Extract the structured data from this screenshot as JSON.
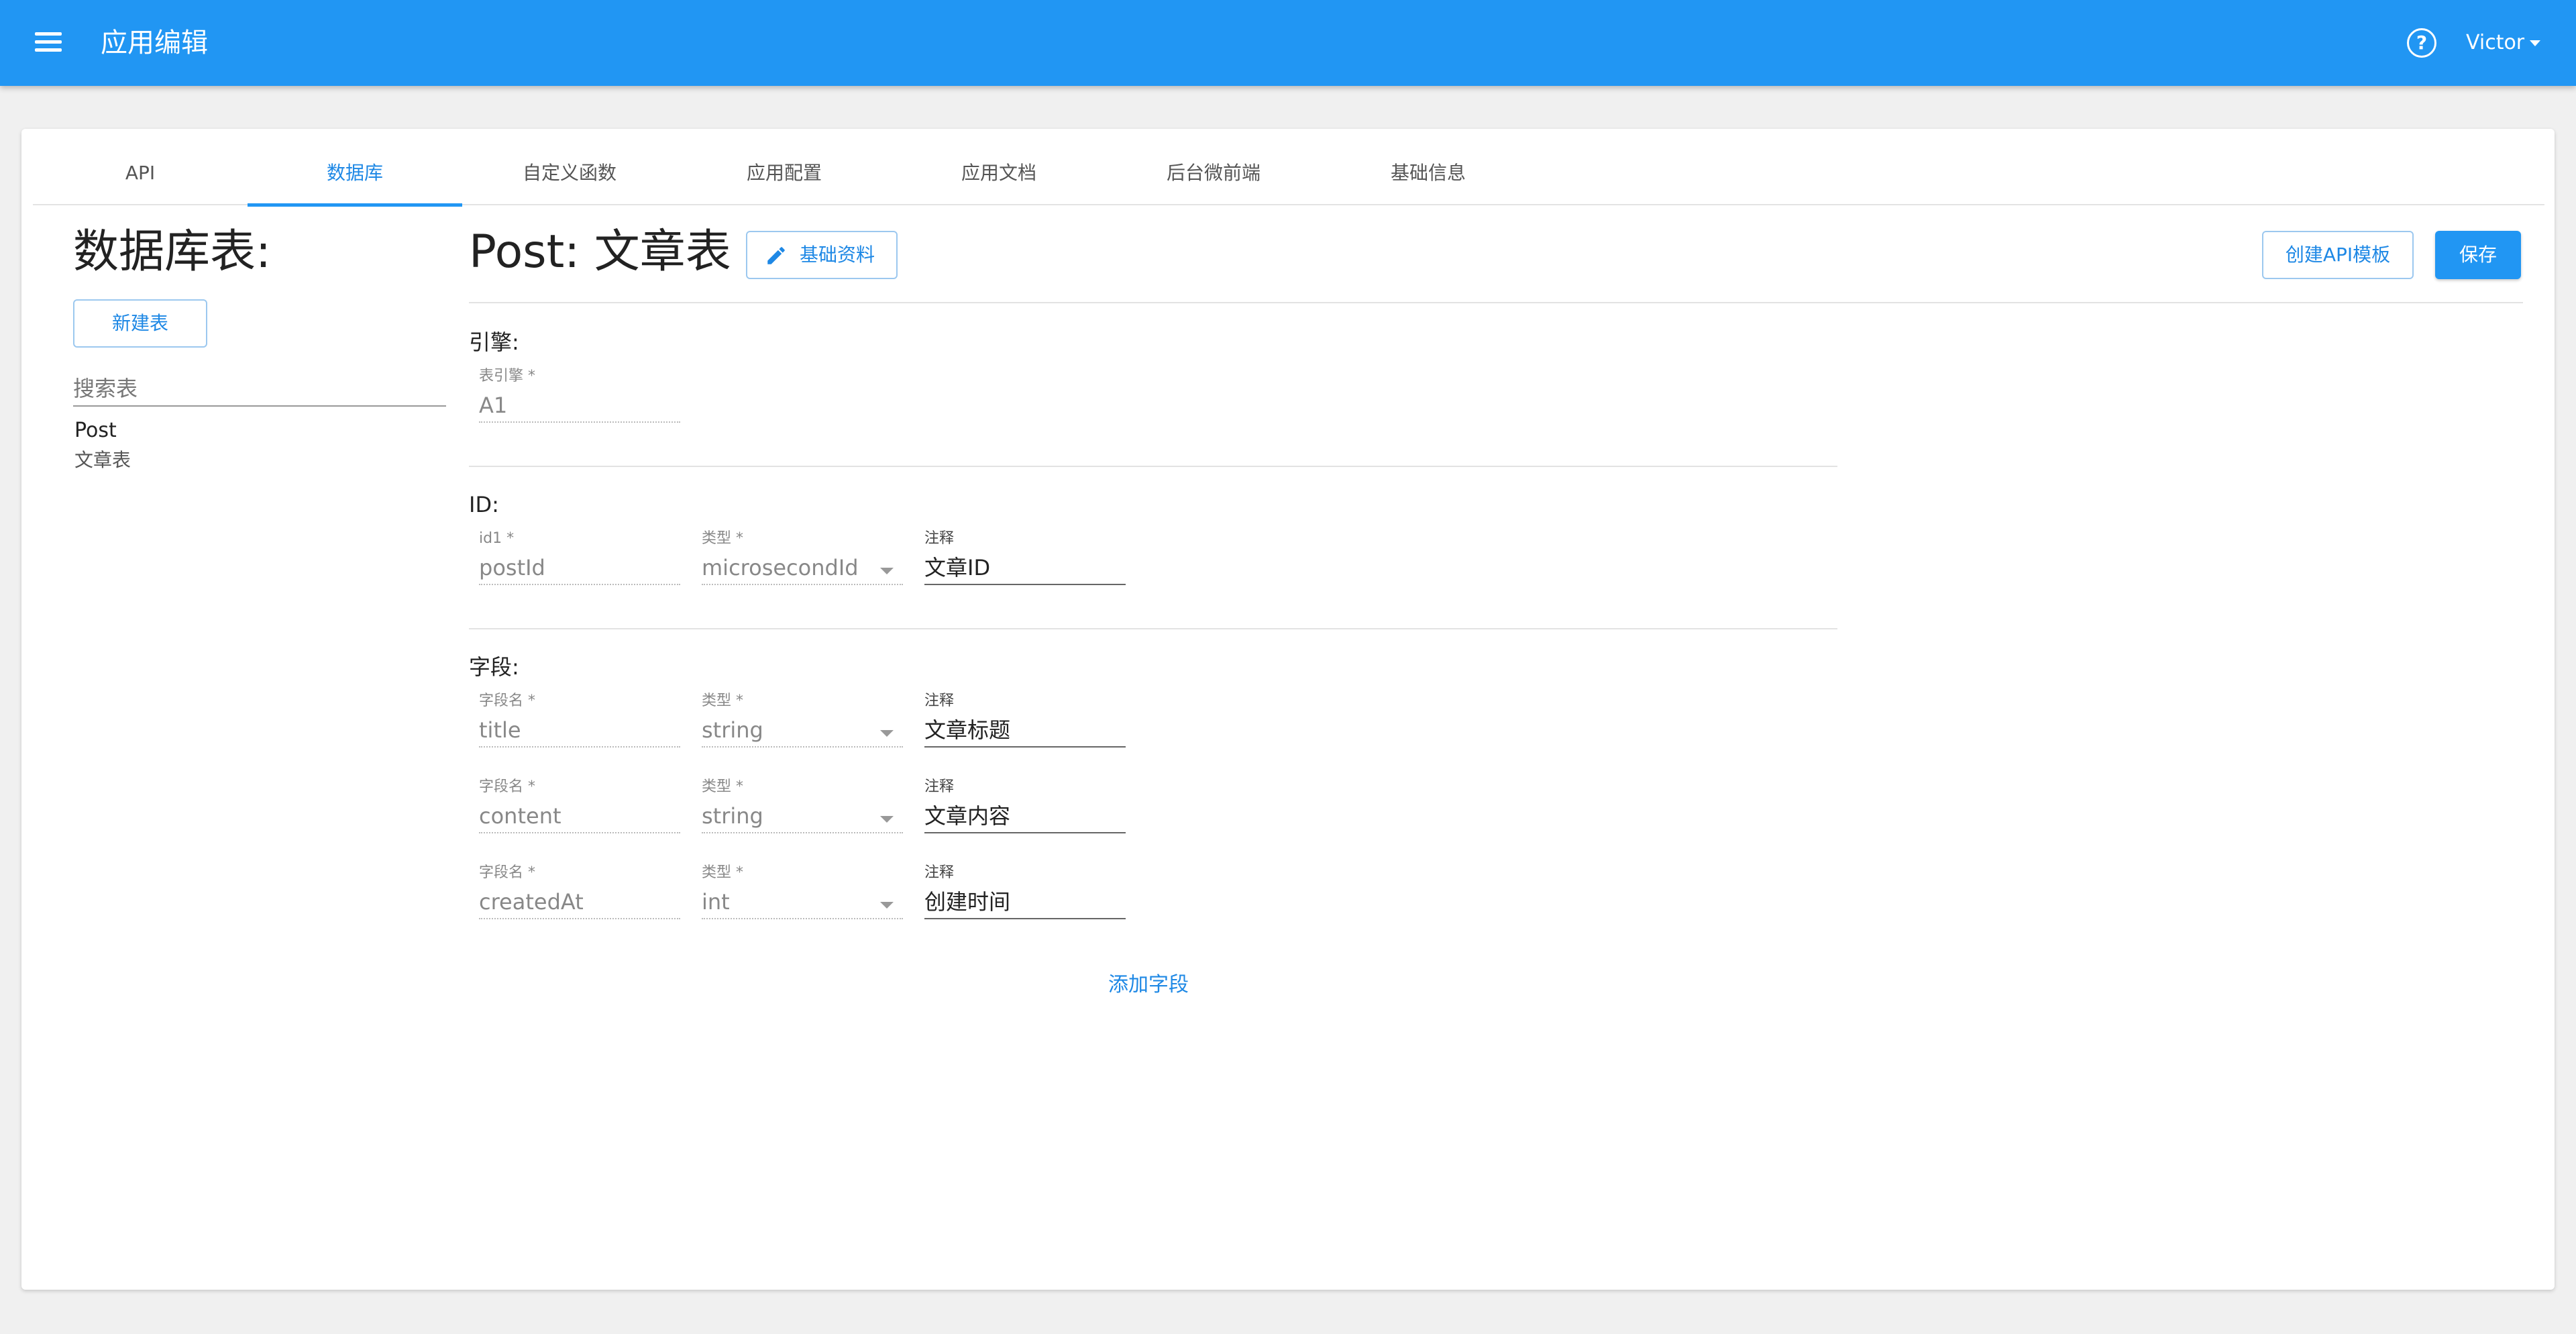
{
  "appbar": {
    "title": "应用编辑",
    "user_name": "Victor"
  },
  "tabs": [
    {
      "label": "API"
    },
    {
      "label": "数据库"
    },
    {
      "label": "自定义函数"
    },
    {
      "label": "应用配置"
    },
    {
      "label": "应用文档"
    },
    {
      "label": "后台微前端"
    },
    {
      "label": "基础信息"
    }
  ],
  "active_tab": "数据库",
  "left_panel": {
    "title": "数据库表:",
    "new_table_label": "新建表",
    "search_placeholder": "搜索表",
    "tables": [
      {
        "name": "Post",
        "comment": "文章表"
      }
    ]
  },
  "editor": {
    "title": "Post: 文章表",
    "basic_info_label": "基础资料",
    "create_api_template_label": "创建API模板",
    "save_label": "保存",
    "engine_section": {
      "label": "引擎:",
      "engine_field_label": "表引擎 *",
      "engine_value": "A1"
    },
    "id_section": {
      "label": "ID:",
      "id_field_label": "id1 *",
      "id_value": "postId",
      "type_label": "类型 *",
      "type_value": "microsecondId",
      "comment_label": "注释",
      "comment_value": "文章ID"
    },
    "fields_section": {
      "label": "字段:",
      "rows": [
        {
          "name_label": "字段名 *",
          "name": "title",
          "type_label": "类型 *",
          "type": "string",
          "comment_label": "注释",
          "comment": "文章标题"
        },
        {
          "name_label": "字段名 *",
          "name": "content",
          "type_label": "类型 *",
          "type": "string",
          "comment_label": "注释",
          "comment": "文章内容"
        },
        {
          "name_label": "字段名 *",
          "name": "createdAt",
          "type_label": "类型 *",
          "type": "int",
          "comment_label": "注释",
          "comment": "创建时间"
        }
      ],
      "add_field_label": "添加字段"
    }
  },
  "colors": {
    "primary": "#2196f3",
    "accent_text": "#1e88e5",
    "background": "#f0f0f0"
  },
  "icons": [
    "menu-icon",
    "help-icon",
    "caret-down-icon",
    "pencil-icon",
    "select-caret-icon"
  ]
}
